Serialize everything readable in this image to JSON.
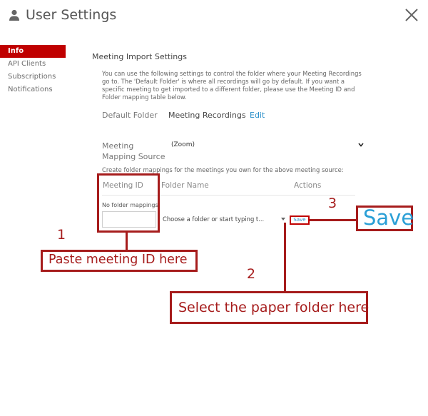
{
  "header": {
    "title": "User Settings"
  },
  "sidebar": {
    "items": [
      {
        "label": "Info",
        "active": true
      },
      {
        "label": "API Clients"
      },
      {
        "label": "Subscriptions"
      },
      {
        "label": "Notifications"
      }
    ]
  },
  "main": {
    "section_title": "Meeting Import Settings",
    "description": "You can use the following settings to control the folder where your Meeting Recordings go to. The 'Default Folder' is where all recordings will go by default. If you want a specific meeting to get imported to a different folder, please use the Meeting ID and Folder mapping table below.",
    "default_folder_label": "Default Folder",
    "default_folder_value": "Meeting Recordings",
    "edit_label": "Edit",
    "mapping_source_label": "Meeting Mapping Source",
    "mapping_source_value": "(Zoom)",
    "create_text": "Create folder mappings for the meetings you own for the above meeting source:",
    "table": {
      "headers": [
        "Meeting ID",
        "Folder Name",
        "Actions"
      ],
      "empty_text": "No folder mappings",
      "meeting_id_value": "",
      "folder_placeholder": "Choose a folder or start typing t...",
      "save_label": "Save"
    }
  },
  "annotations": {
    "num1": "1",
    "num2": "2",
    "num3": "3",
    "paste_text": "Paste meeting ID here",
    "select_text": "Select the paper folder here",
    "save_text": "Save",
    "save_color": "#2a9fd6",
    "annotation_color": "#a61c1c"
  }
}
